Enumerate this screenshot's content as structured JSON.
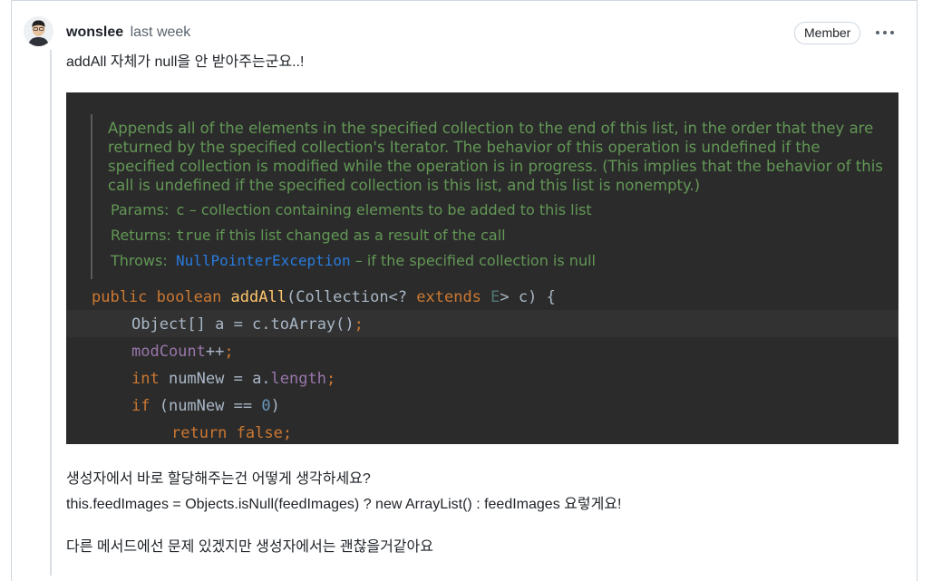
{
  "comment": {
    "author": "wonslee",
    "time": "last week",
    "badge": "Member",
    "body_line1": "addAll 자체가 null을 안 받아주는군요..!",
    "body_line2": "생성자에서 바로 할당해주는건 어떻게 생각하세요?",
    "body_line3": "this.feedImages = Objects.isNull(feedImages) ? new ArrayList() : feedImages 요렇게요!",
    "body_line4": "다른 메서드에선 문제 있겠지만 생성자에서는 괜찮을거같아요"
  },
  "code_screenshot": {
    "doc_description": "Appends all of the elements in the specified collection to the end of this list, in the order that they are returned by the specified collection's Iterator. The behavior of this operation is undefined if the specified collection is modified while the operation is in progress. (This implies that the behavior of this call is undefined if the specified collection is this list, and this list is nonempty.)",
    "params_label": "Params:",
    "params_name": "c",
    "params_text": " – collection containing elements to be added to this list",
    "returns_label": "Returns:",
    "returns_code": "true",
    "returns_text": " if this list changed as a result of the call",
    "throws_label": "Throws:",
    "throws_link": "NullPointerException",
    "throws_text": " – if the specified collection is null",
    "code": {
      "l1_kw1": "public ",
      "l1_kw2": "boolean ",
      "l1_fn": "addAll",
      "l1_a": "(Collection<? ",
      "l1_kw3": "extends ",
      "l1_tp": "E",
      "l1_b": "> c) {",
      "l2_a": "Object[] a = c.toArray()",
      "l2_semi": ";",
      "l3_fld": "modCount",
      "l3_a": "++",
      "l3_semi": ";",
      "l4_kw": "int ",
      "l4_a": "numNew = a.",
      "l4_fld": "length",
      "l4_semi": ";",
      "l5_kw": "if ",
      "l5_a": "(numNew == ",
      "l5_num": "0",
      "l5_b": ")",
      "l6_kw": "return false;"
    }
  }
}
